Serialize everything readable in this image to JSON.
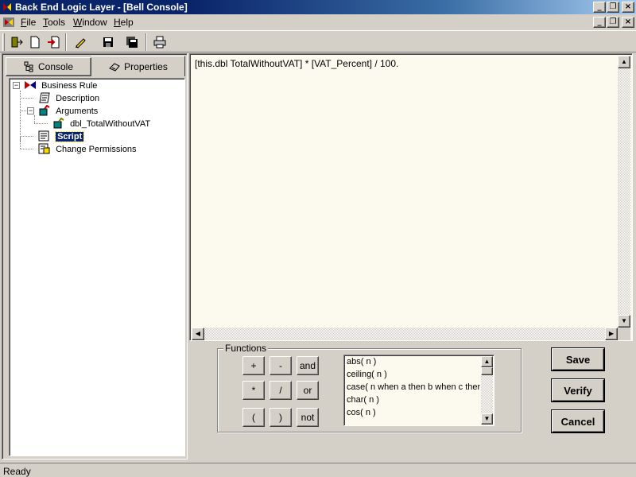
{
  "window": {
    "title": "Back End Logic Layer - [Bell Console]"
  },
  "menu": {
    "items": [
      {
        "key": "F",
        "rest": "ile"
      },
      {
        "key": "T",
        "rest": "ools"
      },
      {
        "key": "W",
        "rest": "indow"
      },
      {
        "key": "H",
        "rest": "elp"
      }
    ]
  },
  "toolbar": {
    "buttons": [
      "exit-icon",
      "new-document-icon",
      "import-icon",
      "edit-pencil-icon",
      "save-disk-icon",
      "save-all-disk-icon",
      "print-icon"
    ]
  },
  "tabs": {
    "console": "Console",
    "properties": "Properties"
  },
  "tree": {
    "business_rule": "Business Rule",
    "description": "Description",
    "arguments": "Arguments",
    "argument_item": "dbl_TotalWithoutVAT",
    "script": "Script",
    "change_permissions": "Change Permissions"
  },
  "editor": {
    "text": "[this.dbl TotalWithoutVAT] * [VAT_Percent] / 100."
  },
  "functions": {
    "legend": "Functions",
    "operators": [
      "+",
      "-",
      "and",
      "*",
      "/",
      "or",
      "(",
      ")",
      "not"
    ],
    "list": [
      "abs( n )",
      "ceiling( n )",
      "case( n when a then b when c then",
      "char( n )",
      "cos( n )"
    ]
  },
  "actions": {
    "save": "Save",
    "verify": "Verify",
    "cancel": "Cancel"
  },
  "status": {
    "text": "Ready"
  },
  "colors": {
    "title_active": "#0a246a",
    "editor_bg": "#fcfaef",
    "selection": "#0a246a",
    "face": "#d4d0c8"
  }
}
